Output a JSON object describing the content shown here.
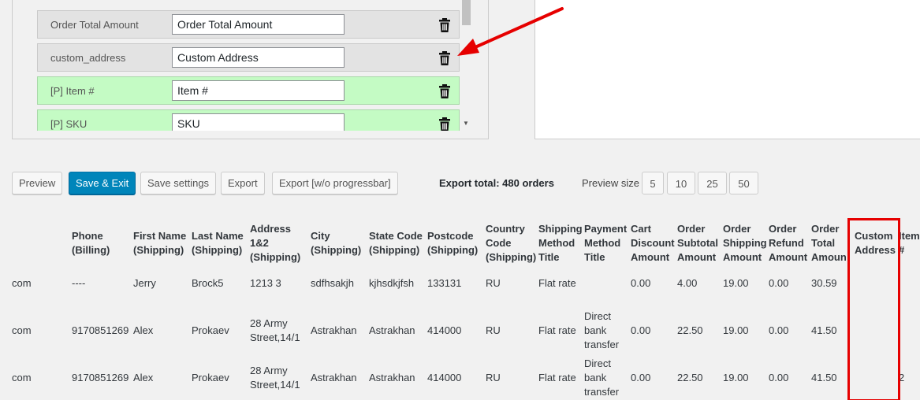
{
  "fields": [
    {
      "key": "Order Total Amount",
      "value": "Order Total Amount",
      "type": "order"
    },
    {
      "key": "custom_address",
      "value": "Custom Address",
      "type": "order"
    },
    {
      "key": "[P] Item #",
      "value": "Item #",
      "type": "product"
    },
    {
      "key": "[P] SKU",
      "value": "SKU",
      "type": "product"
    }
  ],
  "toolbar": {
    "preview": "Preview",
    "save_exit": "Save & Exit",
    "save_settings": "Save settings",
    "export": "Export",
    "export_no_progress": "Export [w/o progressbar]",
    "export_total": "Export total: 480 orders",
    "preview_size_label": "Preview size",
    "sizes": [
      "5",
      "10",
      "25",
      "50"
    ]
  },
  "colors": {
    "primary": "#0085ba",
    "product_row": "#c4fbc4",
    "annotation": "#e60000"
  },
  "table": {
    "columns": [
      [
        "Phone",
        "(Billing)"
      ],
      [
        "First Name",
        "(Shipping)"
      ],
      [
        "Last Name",
        "(Shipping)"
      ],
      [
        "Address",
        "1&2",
        "(Shipping)"
      ],
      [
        "City",
        "(Shipping)"
      ],
      [
        "State Code",
        "(Shipping)"
      ],
      [
        "Postcode",
        "(Shipping)"
      ],
      [
        "Country",
        "Code",
        "(Shipping)"
      ],
      [
        "Shipping",
        "Method",
        "Title"
      ],
      [
        "Payment",
        "Method",
        "Title"
      ],
      [
        "Cart",
        "Discount",
        "Amount"
      ],
      [
        "Order",
        "Subtotal",
        "Amount"
      ],
      [
        "Order",
        "Shipping",
        "Amount"
      ],
      [
        "Order",
        "Refund",
        "Amount"
      ],
      [
        "Order",
        "Total",
        "Amoun"
      ],
      [
        "Custom",
        "Address"
      ],
      [
        "Item",
        "#"
      ]
    ],
    "rows": [
      {
        "email": "com",
        "cells": [
          [
            "----"
          ],
          [
            "Jerry"
          ],
          [
            "Brock5"
          ],
          [
            "1213 3"
          ],
          [
            "sdfhsakjh"
          ],
          [
            "kjhsdkjfsh"
          ],
          [
            "133131"
          ],
          [
            "RU"
          ],
          [
            "Flat rate"
          ],
          [
            ""
          ],
          [
            "0.00"
          ],
          [
            "4.00"
          ],
          [
            "19.00"
          ],
          [
            "0.00"
          ],
          [
            "30.59"
          ],
          [
            ""
          ],
          [
            ""
          ]
        ]
      },
      {
        "email": "com",
        "cells": [
          [
            "9170851269"
          ],
          [
            "Alex"
          ],
          [
            "Prokaev"
          ],
          [
            "28 Army",
            "Street,14/1"
          ],
          [
            "Astrakhan"
          ],
          [
            "Astrakhan"
          ],
          [
            "414000"
          ],
          [
            "RU"
          ],
          [
            "Flat rate"
          ],
          [
            "Direct",
            "bank",
            "transfer"
          ],
          [
            "0.00"
          ],
          [
            "22.50"
          ],
          [
            "19.00"
          ],
          [
            "0.00"
          ],
          [
            "41.50"
          ],
          [
            ""
          ],
          [
            ""
          ]
        ]
      },
      {
        "email": "com",
        "cells": [
          [
            "9170851269"
          ],
          [
            "Alex"
          ],
          [
            "Prokaev"
          ],
          [
            "28 Army",
            "Street,14/1"
          ],
          [
            "Astrakhan"
          ],
          [
            "Astrakhan"
          ],
          [
            "414000"
          ],
          [
            "RU"
          ],
          [
            "Flat rate"
          ],
          [
            "Direct",
            "bank",
            "transfer"
          ],
          [
            "0.00"
          ],
          [
            "22.50"
          ],
          [
            "19.00"
          ],
          [
            "0.00"
          ],
          [
            "41.50"
          ],
          [
            ""
          ],
          [
            "2"
          ]
        ]
      }
    ]
  }
}
